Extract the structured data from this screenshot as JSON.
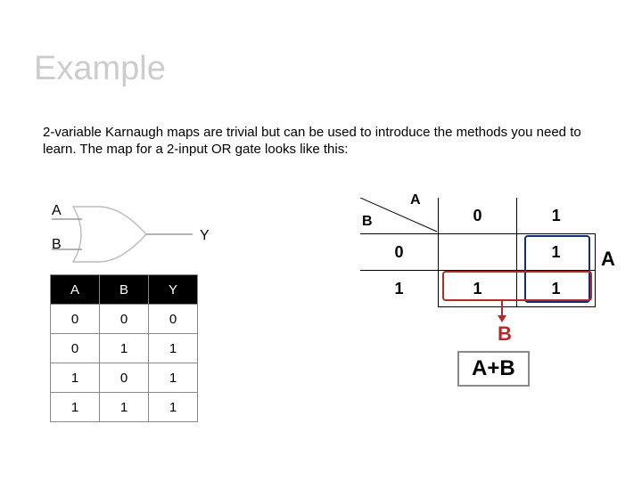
{
  "title": "Example",
  "intro": "2-variable Karnaugh maps are trivial but can be used to introduce the methods you need to learn. The map for a 2-input OR gate looks like this:",
  "gate": {
    "in1": "A",
    "in2": "B",
    "out": "Y"
  },
  "truth": {
    "headers": [
      "A",
      "B",
      "Y"
    ],
    "rows": [
      [
        "0",
        "0",
        "0"
      ],
      [
        "0",
        "1",
        "1"
      ],
      [
        "1",
        "0",
        "1"
      ],
      [
        "1",
        "1",
        "1"
      ]
    ]
  },
  "kmap": {
    "col_var": "A",
    "row_var": "B",
    "col_headers": [
      "0",
      "1"
    ],
    "row_headers": [
      "0",
      "1"
    ],
    "cells": [
      [
        "",
        "1"
      ],
      [
        "1",
        "1"
      ]
    ],
    "group_a_label": "A",
    "group_b_label": "B",
    "result": "A+B"
  },
  "chart_data": {
    "type": "table",
    "title": "2-input OR gate truth table",
    "headers": [
      "A",
      "B",
      "Y"
    ],
    "rows": [
      [
        0,
        0,
        0
      ],
      [
        0,
        1,
        1
      ],
      [
        1,
        0,
        1
      ],
      [
        1,
        1,
        1
      ]
    ],
    "kmap": {
      "row_variable": "B",
      "col_variable": "A",
      "grid": [
        [
          0,
          1
        ],
        [
          1,
          1
        ]
      ],
      "groups": [
        {
          "name": "A",
          "cells": [
            [
              0,
              1
            ],
            [
              1,
              1
            ]
          ]
        },
        {
          "name": "B",
          "cells": [
            [
              1,
              0
            ],
            [
              1,
              1
            ]
          ]
        }
      ],
      "expression": "A+B"
    }
  }
}
